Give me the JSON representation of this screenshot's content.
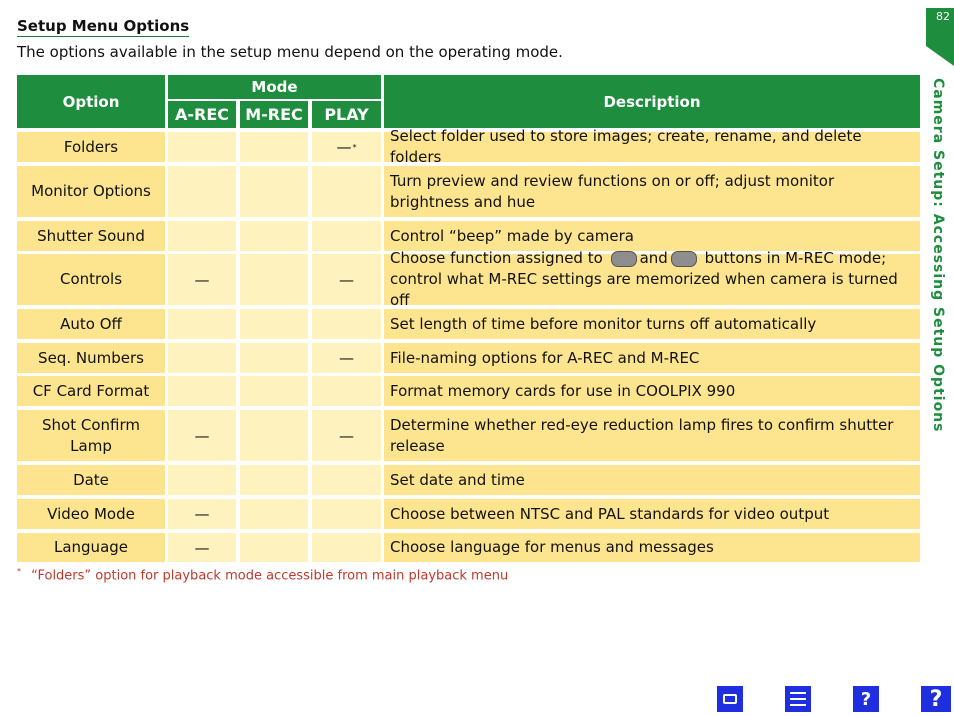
{
  "heading": {
    "title": "Setup Menu Options",
    "intro": "The options available in the setup menu depend on the operating mode."
  },
  "side": {
    "page_number": "82",
    "section_label": "Camera Setup: Accessing Setup Options"
  },
  "table": {
    "header": {
      "option": "Option",
      "mode": "Mode",
      "description": "Description",
      "modes": [
        "A-REC",
        "M-REC",
        "PLAY"
      ]
    },
    "rows": [
      {
        "option": "Folders",
        "arec": "",
        "mrec": "",
        "play": "—",
        "play_note": "*",
        "description": "Select folder used to store images; create, rename, and delete folders"
      },
      {
        "option": "Monitor Options",
        "arec": "",
        "mrec": "",
        "play": "",
        "description": "Turn preview and review functions on or off; adjust monitor brightness and hue"
      },
      {
        "option": "Shutter Sound",
        "arec": "",
        "mrec": "",
        "play": "",
        "description": "Control “beep” made by camera"
      },
      {
        "option": "Controls",
        "arec": "—",
        "mrec": "",
        "play": "—",
        "description_parts": [
          "Choose function assigned to",
          "and",
          "buttons in M-REC mode; control what M-REC settings are memorized when camera is turned off"
        ]
      },
      {
        "option": "Auto Off",
        "arec": "",
        "mrec": "",
        "play": "",
        "description": "Set length of time before monitor turns off automatically"
      },
      {
        "option": "Seq. Numbers",
        "arec": "",
        "mrec": "",
        "play": "—",
        "description": "File-naming options for A-REC and M-REC"
      },
      {
        "option": "CF Card Format",
        "arec": "",
        "mrec": "",
        "play": "",
        "description": "Format memory cards for use in COOLPIX 990"
      },
      {
        "option": "Shot Confirm Lamp",
        "arec": "—",
        "mrec": "",
        "play": "—",
        "description": "Determine whether red-eye reduction lamp fires to confirm shutter release"
      },
      {
        "option": "Date",
        "arec": "",
        "mrec": "",
        "play": "",
        "description": "Set date and time"
      },
      {
        "option": "Video Mode",
        "arec": "—",
        "mrec": "",
        "play": "",
        "description": "Choose between NTSC and PAL standards for video output"
      },
      {
        "option": "Language",
        "arec": "—",
        "mrec": "",
        "play": "",
        "description": "Choose language for menus and messages"
      }
    ]
  },
  "footnote": {
    "marker": "*",
    "text": "“Folders” option for playback mode accessible from main playback menu"
  },
  "footer_icons": [
    "camera-icon",
    "contents-icon",
    "index-icon",
    "help-icon"
  ],
  "colors": {
    "header_green": "#1e8e3e",
    "row_yellow": "#fde58f",
    "mode_cell": "#fef3bf",
    "nav_blue": "#1f2fe0"
  }
}
